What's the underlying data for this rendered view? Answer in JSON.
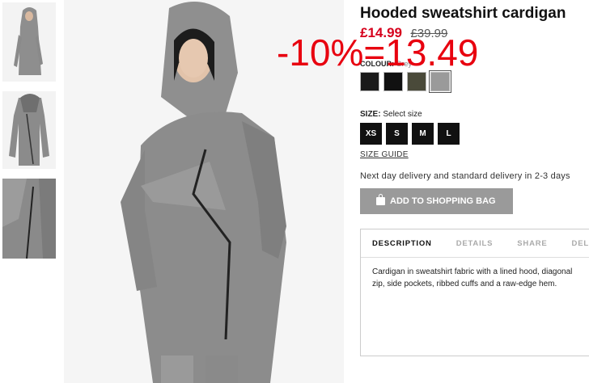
{
  "product": {
    "title": "Hooded sweatshirt cardigan",
    "price_sale": "£14.99",
    "price_old": "£39.99",
    "overlay_text": "-10%=13.49"
  },
  "colour": {
    "label": "COLOUR:",
    "value": "Grey",
    "swatches": [
      {
        "name": "black",
        "color": "#1a1a1a"
      },
      {
        "name": "black-2",
        "color": "#111111"
      },
      {
        "name": "khaki",
        "color": "#4a4a3a"
      },
      {
        "name": "grey",
        "color": "#9a9a9a"
      }
    ]
  },
  "size": {
    "label": "SIZE:",
    "placeholder": "Select size",
    "options": [
      "XS",
      "S",
      "M",
      "L"
    ],
    "guide_label": "SIZE GUIDE"
  },
  "delivery_text": "Next day delivery and standard delivery in 2-3 days",
  "add_to_bag_label": "ADD TO SHOPPING BAG",
  "tabs": [
    "DESCRIPTION",
    "DETAILS",
    "SHARE",
    "DELIVERY"
  ],
  "description": "Cardigan in sweatshirt fabric with a lined hood, diagonal zip, side pockets, ribbed cuffs and a raw-edge hem."
}
